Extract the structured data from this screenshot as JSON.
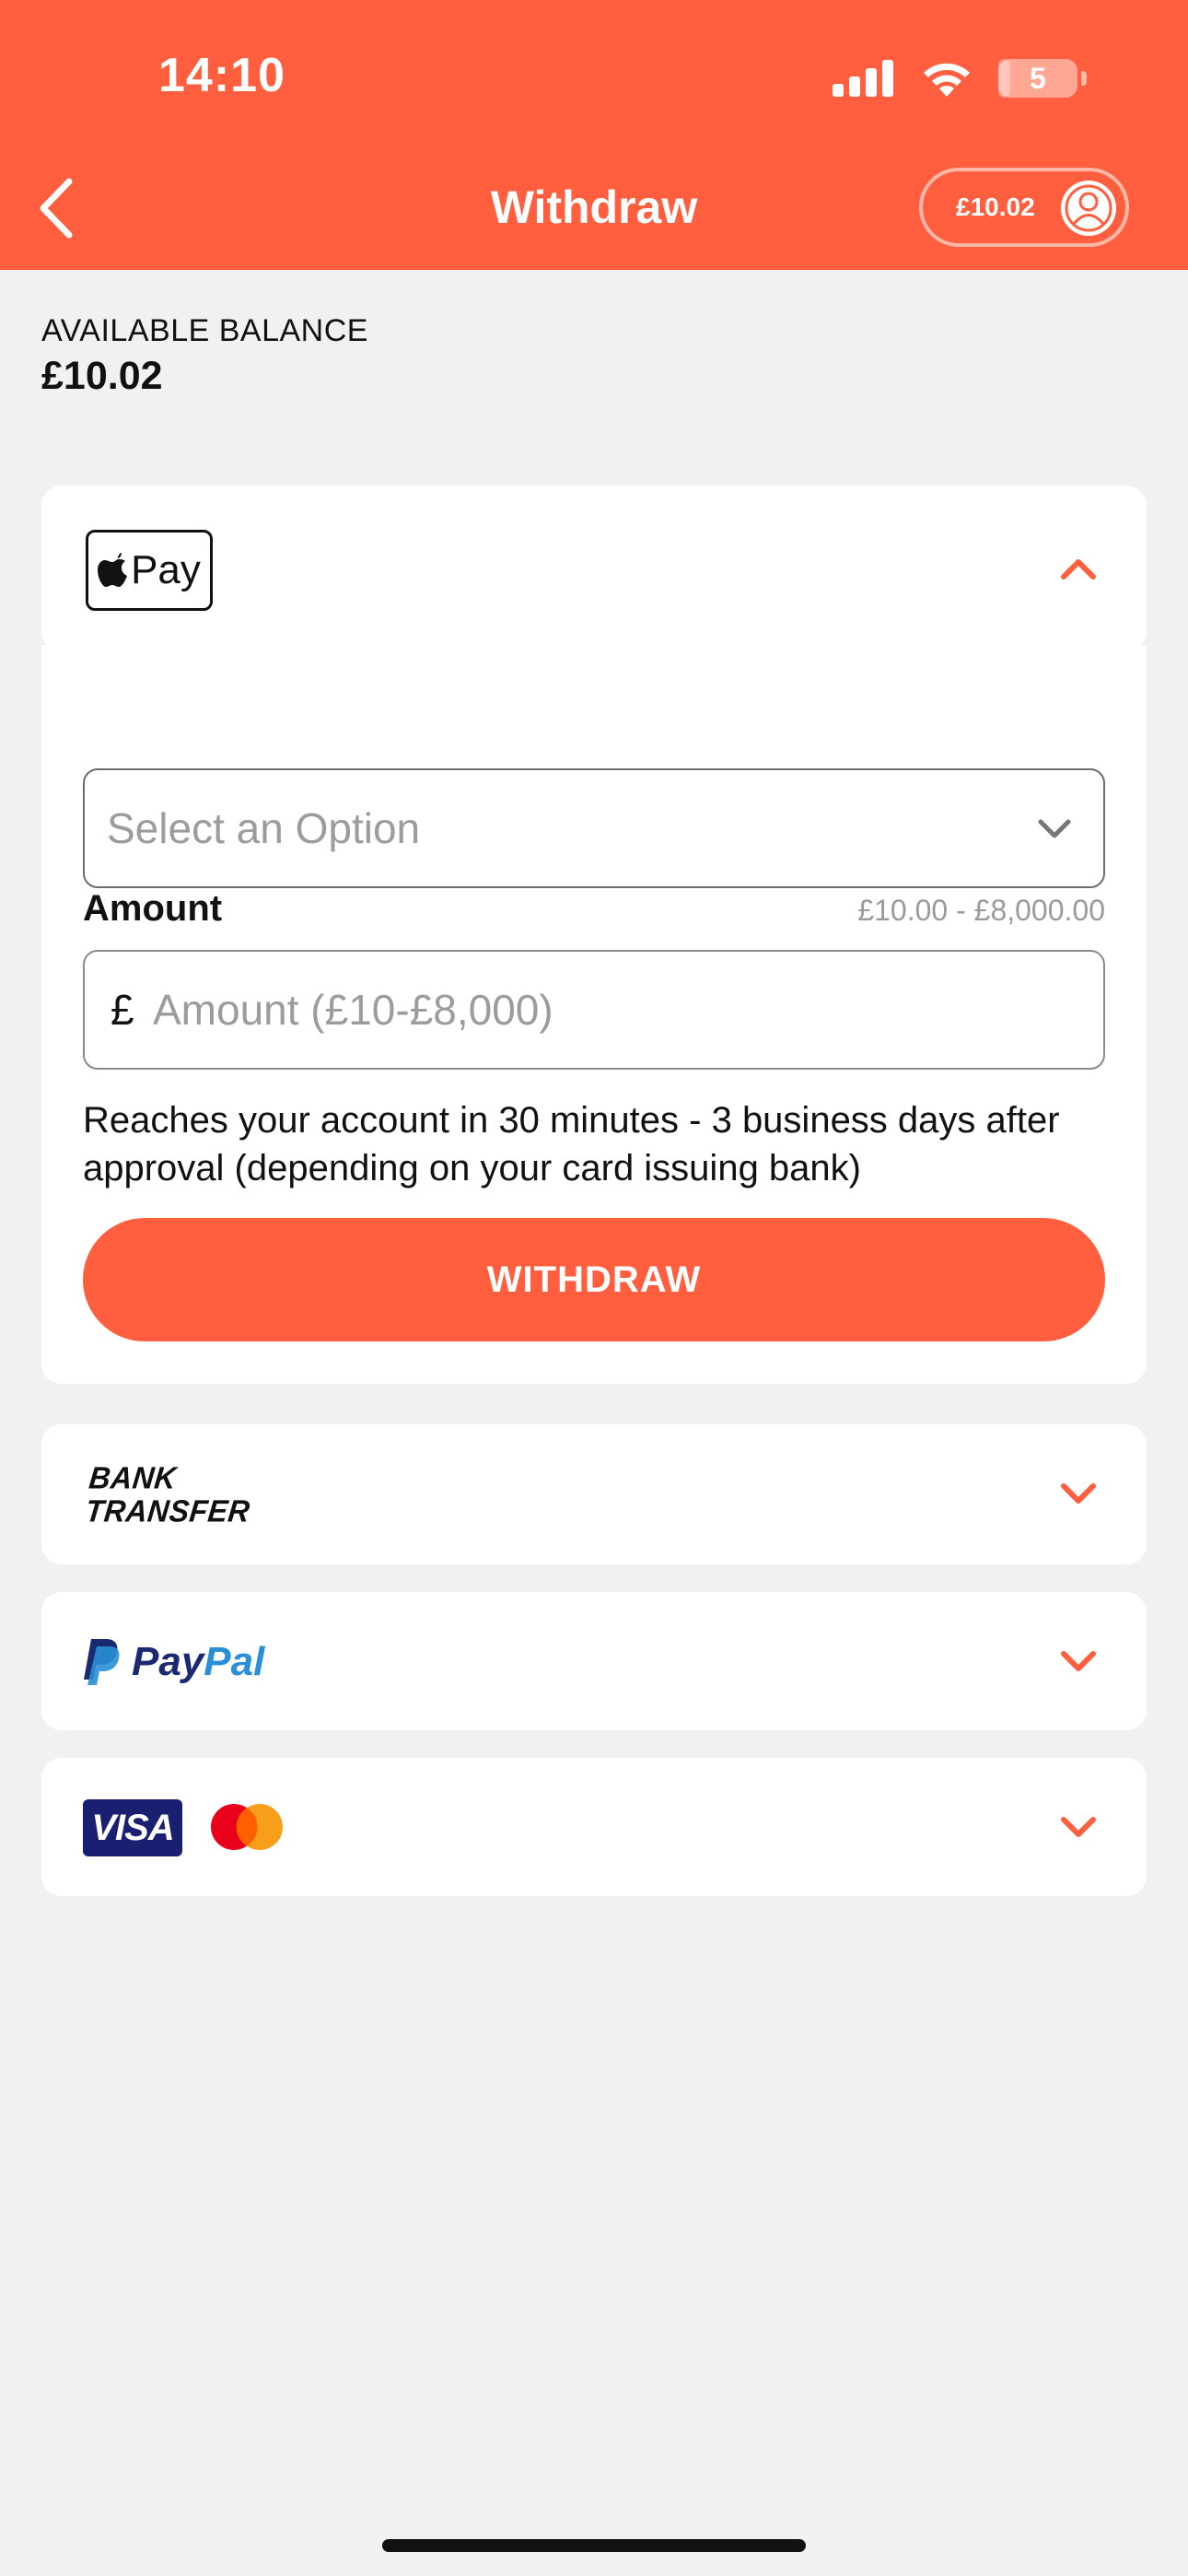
{
  "status_bar": {
    "time": "14:10",
    "battery": "5",
    "battery_level": 0.05
  },
  "header": {
    "title": "Withdraw",
    "balance": "£10.02"
  },
  "balance": {
    "label": "AVAILABLE BALANCE",
    "value": "£10.02"
  },
  "apple_pay": {
    "logo_text": "Pay",
    "select_placeholder": "Select an Option",
    "amount_label": "Amount",
    "amount_range": "£10.00 - £8,000.00",
    "currency_symbol": "£",
    "amount_placeholder": "Amount (£10-£8,000)",
    "info": "Reaches your account in 30 minutes - 3 business days after approval (depending on your card issuing bank)",
    "withdraw_label": "WITHDRAW"
  },
  "methods": {
    "bank_transfer": {
      "line1": "BANK",
      "line2": "TRANSFER"
    },
    "paypal": {
      "pay": "Pay",
      "pal": "Pal"
    },
    "cards": {
      "visa": "VISA"
    }
  },
  "colors": {
    "brand": "#ff5f3e",
    "paypal_dark": "#1b2a70",
    "paypal_light": "#2a8fd6",
    "visa": "#1a1f71"
  }
}
